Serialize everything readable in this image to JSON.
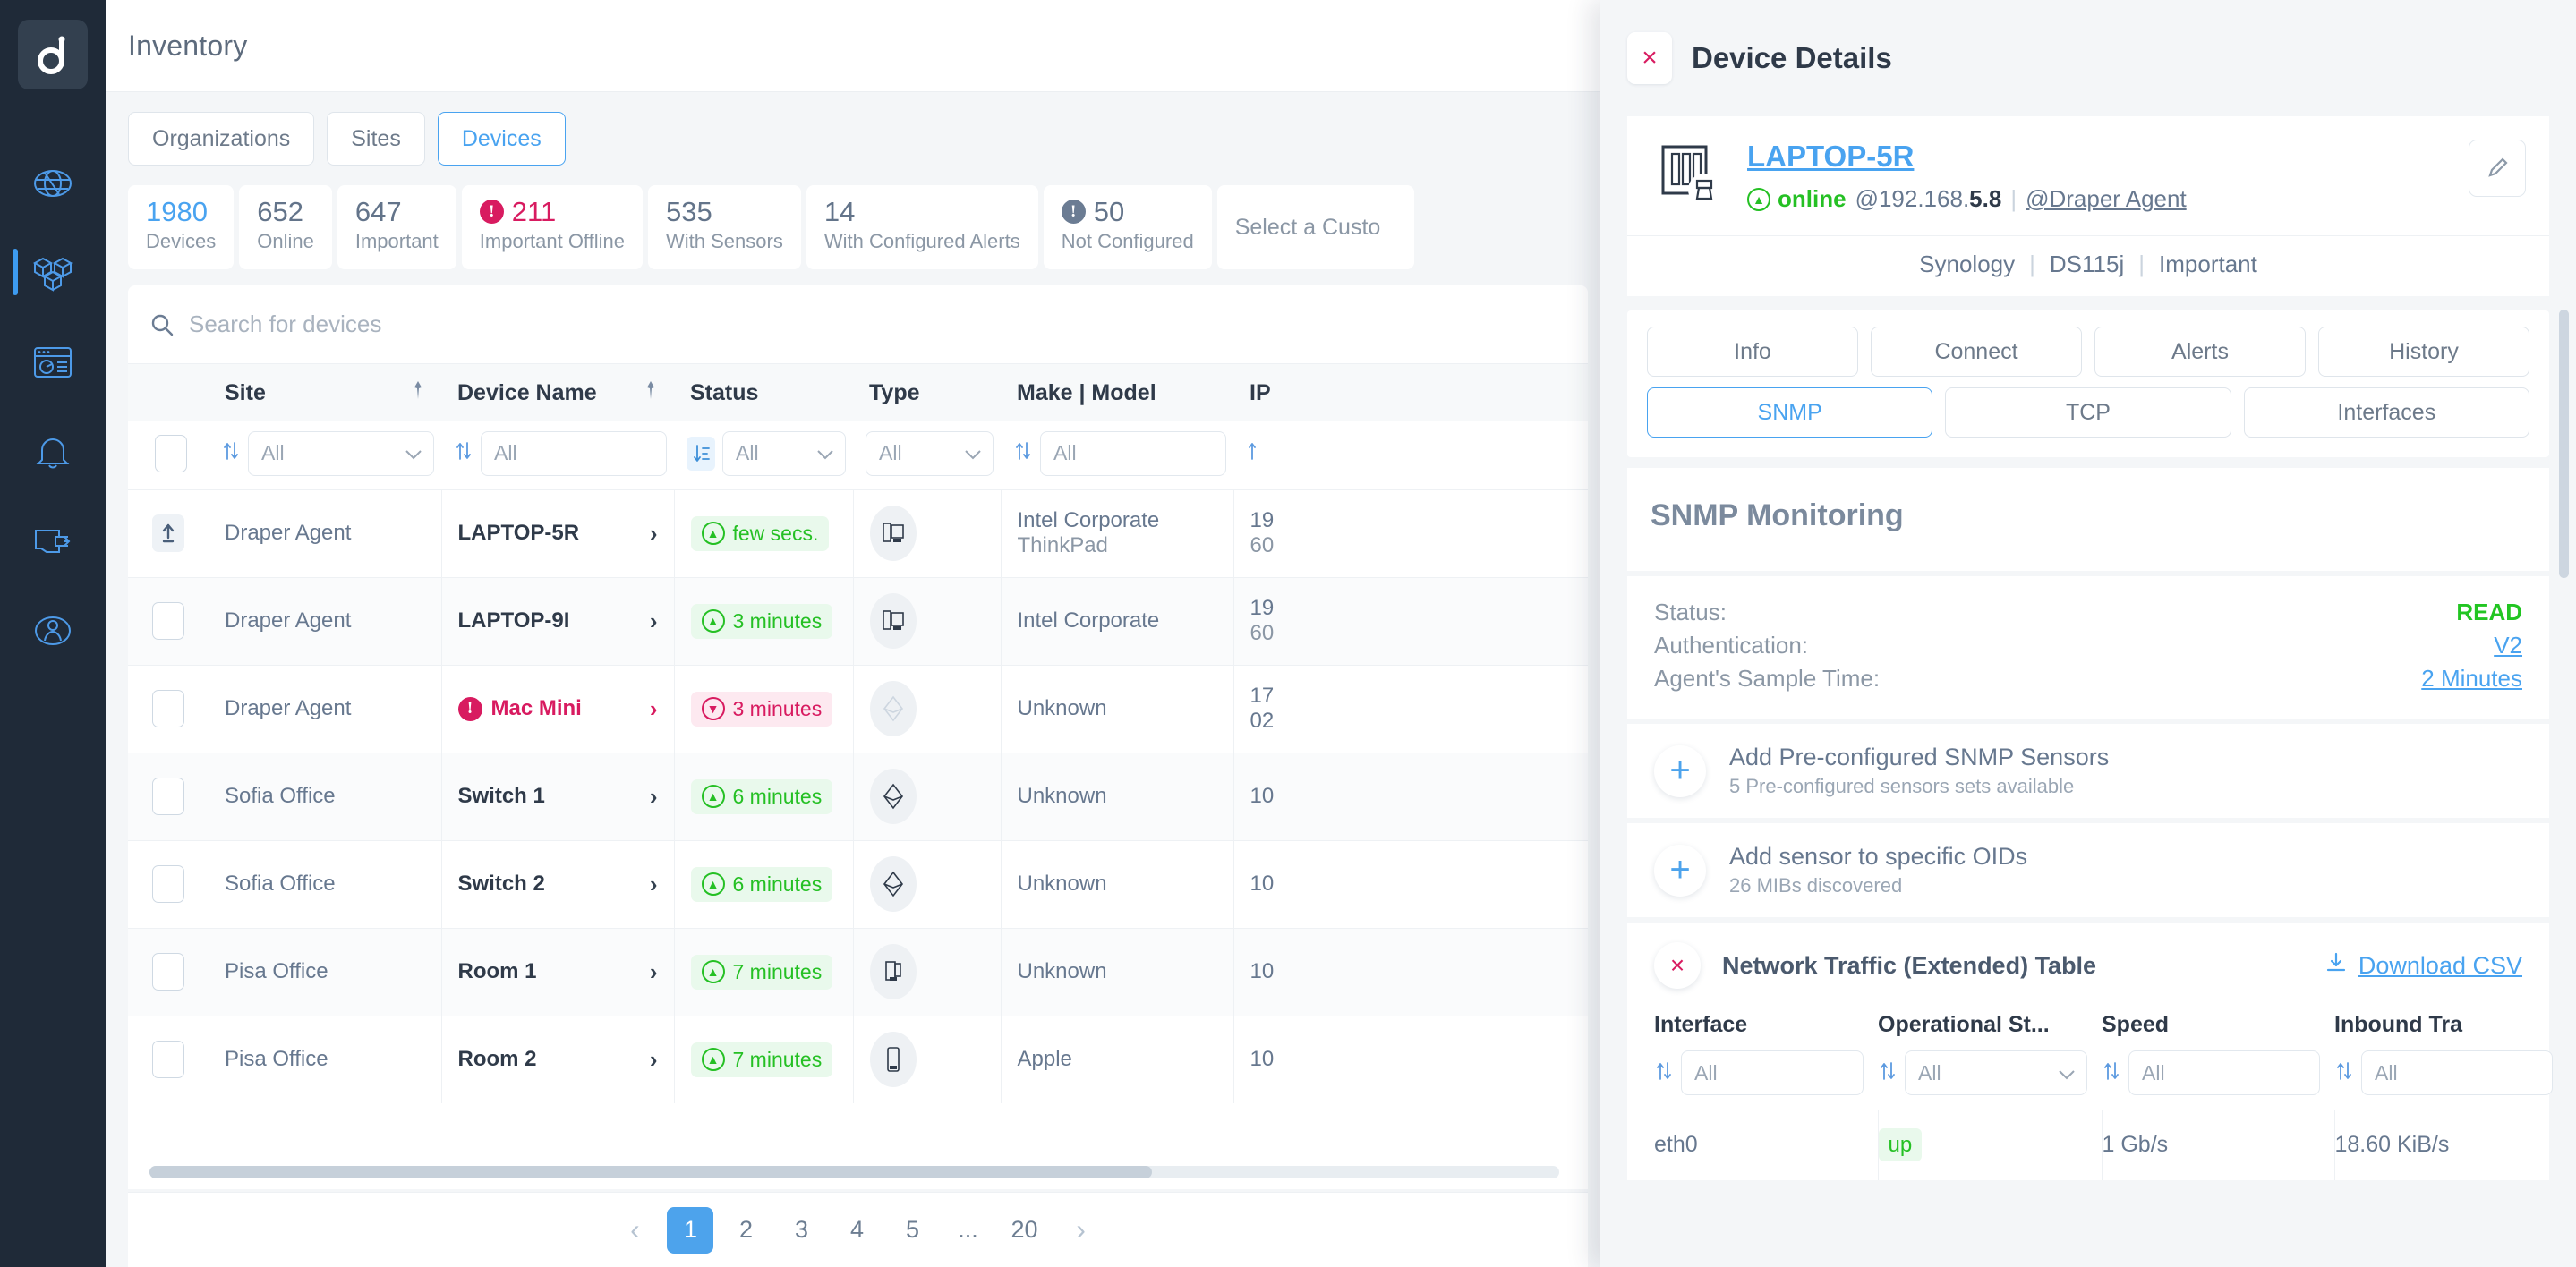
{
  "sidebar": {
    "logo": "d-logo-icon",
    "items": [
      {
        "name": "globe-icon",
        "active": false
      },
      {
        "name": "inventory-boxes-icon",
        "active": true
      },
      {
        "name": "dashboard-icon",
        "active": false
      },
      {
        "name": "bell-icon",
        "active": false
      },
      {
        "name": "logout-icon",
        "active": false
      },
      {
        "name": "user-icon",
        "active": false
      }
    ]
  },
  "header": {
    "title": "Inventory"
  },
  "segments": [
    {
      "label": "Organizations",
      "active": false
    },
    {
      "label": "Sites",
      "active": false
    },
    {
      "label": "Devices",
      "active": true
    }
  ],
  "stats": [
    {
      "value": "1980",
      "label": "Devices",
      "color": "blue",
      "icon": ""
    },
    {
      "value": "652",
      "label": "Online",
      "color": "slate",
      "icon": ""
    },
    {
      "value": "647",
      "label": "Important",
      "color": "slate",
      "icon": ""
    },
    {
      "value": "211",
      "label": "Important Offline",
      "color": "pink",
      "icon": "alert-icon"
    },
    {
      "value": "535",
      "label": "With Sensors",
      "color": "slate",
      "icon": ""
    },
    {
      "value": "14",
      "label": "With Configured Alerts",
      "color": "slate",
      "icon": ""
    },
    {
      "value": "50",
      "label": "Not Configured",
      "color": "slate",
      "icon": "info-icon"
    }
  ],
  "customer_select": "Select a Custo",
  "search": {
    "placeholder": "Search for devices",
    "value": ""
  },
  "table": {
    "columns": [
      {
        "label": "Site",
        "pinned": true,
        "filter": "All",
        "filter_type": "select",
        "sorted": false
      },
      {
        "label": "Device Name",
        "pinned": true,
        "filter": "All",
        "filter_type": "text",
        "sorted": false
      },
      {
        "label": "Status",
        "pinned": false,
        "filter": "All",
        "filter_type": "select",
        "sorted": true
      },
      {
        "label": "Type",
        "pinned": false,
        "filter": "All",
        "filter_type": "select",
        "sorted": false
      },
      {
        "label": "Make | Model",
        "pinned": false,
        "filter": "All",
        "filter_type": "text",
        "sorted": false
      },
      {
        "label": "IP",
        "pinned": false,
        "filter": "All",
        "filter_type": "text",
        "sorted": false
      }
    ],
    "rows": [
      {
        "selected": true,
        "site": "Draper Agent",
        "device": "LAPTOP-5R",
        "alert": false,
        "status": "few secs.",
        "status_state": "up",
        "type_icon": "laptop-icon",
        "type_muted": false,
        "make": "Intel Corporate",
        "model": "ThinkPad",
        "ip": "19",
        "ip2": "60"
      },
      {
        "selected": false,
        "site": "Draper Agent",
        "device": "LAPTOP-9I",
        "alert": false,
        "status": "3 minutes",
        "status_state": "up",
        "type_icon": "laptop-icon",
        "type_muted": false,
        "make": "Intel Corporate",
        "model": "",
        "ip": "19",
        "ip2": "60"
      },
      {
        "selected": false,
        "site": "Draper Agent",
        "device": "Mac Mini",
        "alert": true,
        "status": "3 minutes",
        "status_state": "down",
        "type_icon": "diamond-icon",
        "type_muted": true,
        "make": "Unknown",
        "model": "",
        "ip": "17",
        "ip2": "02"
      },
      {
        "selected": false,
        "site": "Sofia Office",
        "device": "Switch 1",
        "alert": false,
        "status": "6 minutes",
        "status_state": "up",
        "type_icon": "diamond-icon",
        "type_muted": false,
        "make": "Unknown",
        "model": "",
        "ip": "10",
        "ip2": ""
      },
      {
        "selected": false,
        "site": "Sofia Office",
        "device": "Switch 2",
        "alert": false,
        "status": "6 minutes",
        "status_state": "up",
        "type_icon": "diamond-icon",
        "type_muted": false,
        "make": "Unknown",
        "model": "",
        "ip": "10",
        "ip2": ""
      },
      {
        "selected": false,
        "site": "Pisa Office",
        "device": "Room 1",
        "alert": false,
        "status": "7 minutes",
        "status_state": "up",
        "type_icon": "laptop-icon",
        "type_muted": false,
        "make": "Unknown",
        "model": "",
        "ip": "10",
        "ip2": ""
      },
      {
        "selected": false,
        "site": "Pisa Office",
        "device": "Room 2",
        "alert": false,
        "status": "7 minutes",
        "status_state": "up",
        "type_icon": "phone-icon",
        "type_muted": false,
        "make": "Apple",
        "model": "",
        "ip": "10",
        "ip2": ""
      }
    ]
  },
  "pagination": {
    "prev": "‹",
    "next": "›",
    "pages": [
      "1",
      "2",
      "3",
      "4",
      "5",
      "...",
      "20"
    ],
    "current": "1"
  },
  "panel": {
    "title": "Device Details",
    "close": "×",
    "device": {
      "name": "LAPTOP-5R",
      "status": "online",
      "ip_prefix": "@192.168.",
      "ip_suffix": "5.8",
      "agent": "@Draper Agent",
      "vendor": "Synology",
      "model": "DS115j",
      "importance": "Important",
      "edit_icon": "pencil-icon"
    },
    "tabs_row1": [
      {
        "label": "Info",
        "active": false
      },
      {
        "label": "Connect",
        "active": false
      },
      {
        "label": "Alerts",
        "active": false
      },
      {
        "label": "History",
        "active": false
      }
    ],
    "tabs_row2": [
      {
        "label": "SNMP",
        "active": true
      },
      {
        "label": "TCP",
        "active": false
      },
      {
        "label": "Interfaces",
        "active": false
      }
    ],
    "snmp": {
      "title": "SNMP Monitoring",
      "rows": [
        {
          "key": "Status:",
          "value": "READ",
          "style": "green"
        },
        {
          "key": "Authentication:",
          "value": "V2",
          "style": "link"
        },
        {
          "key": "Agent's Sample Time:",
          "value": "2 Minutes",
          "style": "link"
        }
      ],
      "actions": [
        {
          "title": "Add Pre-configured SNMP Sensors",
          "subtitle": "5 Pre-configured sensors sets available",
          "icon": "plus-icon"
        },
        {
          "title": "Add sensor to specific OIDs",
          "subtitle": "26 MIBs discovered",
          "icon": "plus-icon"
        }
      ]
    },
    "network_traffic": {
      "title": "Network Traffic (Extended) Table",
      "download": "Download CSV",
      "download_icon": "download-icon",
      "columns": [
        {
          "label": "Interface",
          "filter": "All",
          "filter_type": "text"
        },
        {
          "label": "Operational St...",
          "filter": "All",
          "filter_type": "select"
        },
        {
          "label": "Speed",
          "filter": "All",
          "filter_type": "text"
        },
        {
          "label": "Inbound Tra",
          "filter": "All",
          "filter_type": "text"
        }
      ],
      "rows": [
        {
          "interface": "eth0",
          "operational_status": "up",
          "speed": "1 Gb/s",
          "inbound": "18.60 KiB/s"
        }
      ]
    }
  },
  "colors": {
    "accent": "#49a3f0",
    "danger": "#d81b60",
    "success": "#25c024",
    "rail": "#1f2a38",
    "bg": "#f4f6f8"
  }
}
